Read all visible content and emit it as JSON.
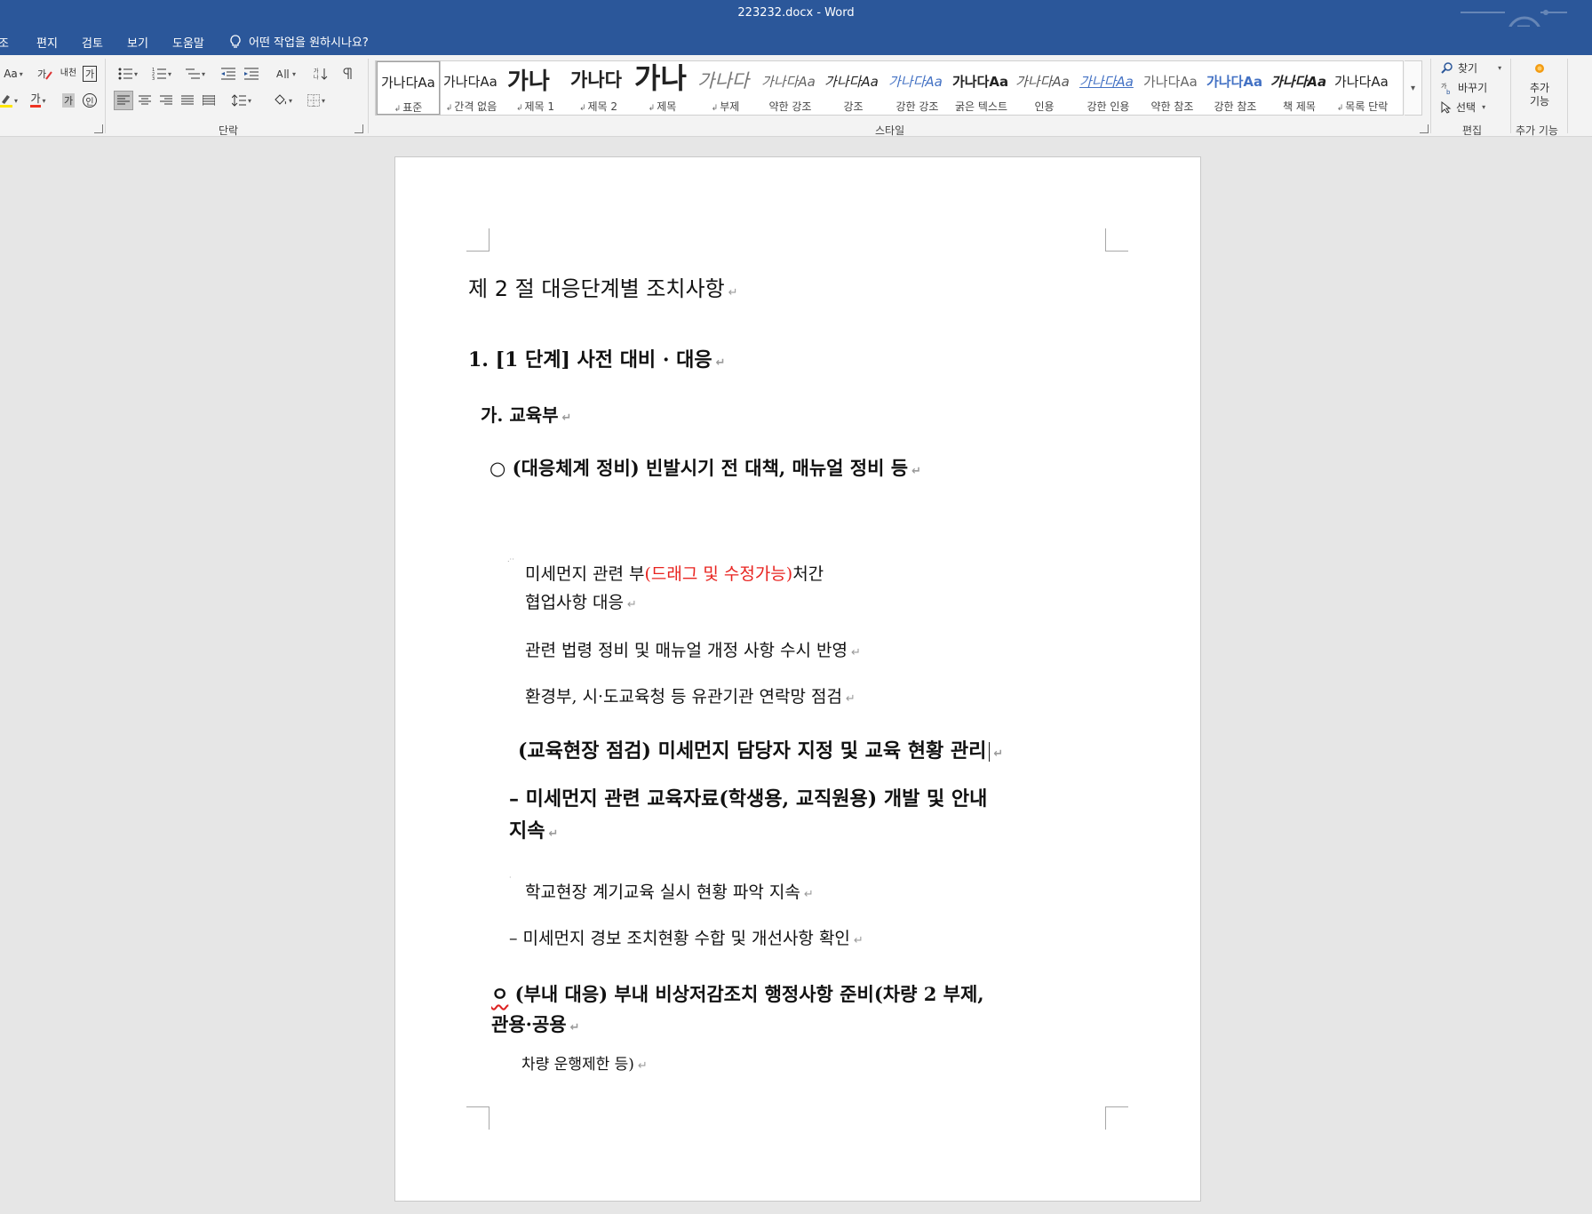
{
  "window": {
    "title": "223232.docx  -  Word"
  },
  "menu": {
    "tabs": [
      "조",
      "편지",
      "검토",
      "보기",
      "도움말"
    ],
    "search_hint": "어떤 작업을 원하시나요?"
  },
  "ribbon": {
    "font_aa": "Aa",
    "font_color_glyph": "가",
    "phonetic_glyph": "내천",
    "char_border_glyph": "가",
    "char_shade_glyph": "가",
    "enclose_glyph": "인",
    "paragraph_label": "단락",
    "styles_label": "스타일",
    "editing_label": "편집",
    "addins_label": "추가 기능",
    "styles": [
      {
        "sample": "가나다Aa",
        "label": "표준",
        "marker": "↲"
      },
      {
        "sample": "가나다Aa",
        "label": "간격 없음",
        "marker": "↲"
      },
      {
        "sample": "가나",
        "label": "제목 1",
        "marker": "↲"
      },
      {
        "sample": "가나다",
        "label": "제목 2",
        "marker": "↲"
      },
      {
        "sample": "가나",
        "label": "제목",
        "marker": "↲"
      },
      {
        "sample": "가나다",
        "label": "부제",
        "marker": "↲"
      },
      {
        "sample": "가나다Aa",
        "label": "약한 강조",
        "marker": ""
      },
      {
        "sample": "가나다Aa",
        "label": "강조",
        "marker": ""
      },
      {
        "sample": "가나다Aa",
        "label": "강한 강조",
        "marker": ""
      },
      {
        "sample": "가나다Aa",
        "label": "굵은 텍스트",
        "marker": ""
      },
      {
        "sample": "가나다Aa",
        "label": "인용",
        "marker": ""
      },
      {
        "sample": "가나다Aa",
        "label": "강한 인용",
        "marker": ""
      },
      {
        "sample": "가나다Aa",
        "label": "약한 참조",
        "marker": ""
      },
      {
        "sample": "가나다Aa",
        "label": "강한 참조",
        "marker": ""
      },
      {
        "sample": "가나다Aa",
        "label": "책 제목",
        "marker": ""
      },
      {
        "sample": "가나다Aa",
        "label": "목록 단락",
        "marker": "↲"
      }
    ],
    "editing": {
      "find": "찾기",
      "replace": "바꾸기",
      "select": "선택"
    },
    "addins": {
      "line1": "추가",
      "line2": "기능"
    }
  },
  "document": {
    "paragraph_mark": "↵",
    "heading": "제 2 절 대응단계별 조치사항",
    "section1": "1. [1 단계] 사전 대비 · 대응",
    "sub_ga": "가. 교육부",
    "item1": "○ (대응체계 정비) 빈발시기 전 대책, 매뉴얼 정비 등",
    "item1a_pre": "미세먼지 관련 부",
    "item1a_red": "(드래그 및 수정가능)",
    "item1a_post": "처간",
    "item1a_line2": "협업사항 대응",
    "item1b": "관련 법령 정비 및 매뉴얼 개정 사항 수시 반영",
    "item1c": "환경부, 시·도교육청 등 유관기관 연락망 점검",
    "item2": "(교육현장 점검) 미세먼지 담당자 지정 및 교육 현황 관리",
    "item2a_line1": "–  미세먼지 관련 교육자료(학생용, 교직원용) 개발 및 안내",
    "item2a_line2": "지속",
    "item2b": "학교현장 계기교육 실시 현황 파악 지속",
    "item2c": "– 미세먼지 경보 조치현황 수합 및 개선사항 확인",
    "item3_circle": "ㅇ",
    "item3_line1": " (부내 대응) 부내 비상저감조치 행정사항 준비(차량 2 부제,",
    "item3_line2": "관용·공용",
    "item3_line3": "차량 운행제한 등)"
  }
}
